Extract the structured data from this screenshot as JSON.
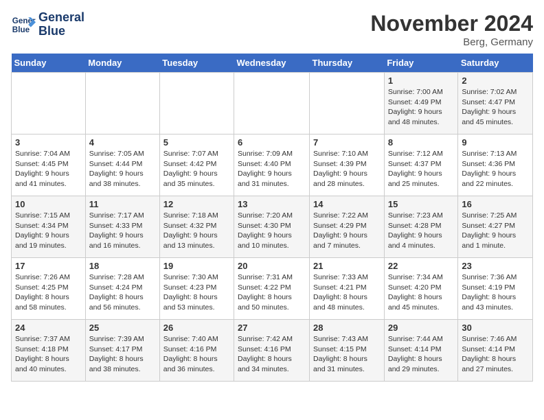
{
  "logo": {
    "line1": "General",
    "line2": "Blue"
  },
  "title": "November 2024",
  "location": "Berg, Germany",
  "days_of_week": [
    "Sunday",
    "Monday",
    "Tuesday",
    "Wednesday",
    "Thursday",
    "Friday",
    "Saturday"
  ],
  "weeks": [
    [
      {
        "day": "",
        "info": ""
      },
      {
        "day": "",
        "info": ""
      },
      {
        "day": "",
        "info": ""
      },
      {
        "day": "",
        "info": ""
      },
      {
        "day": "",
        "info": ""
      },
      {
        "day": "1",
        "info": "Sunrise: 7:00 AM\nSunset: 4:49 PM\nDaylight: 9 hours and 48 minutes."
      },
      {
        "day": "2",
        "info": "Sunrise: 7:02 AM\nSunset: 4:47 PM\nDaylight: 9 hours and 45 minutes."
      }
    ],
    [
      {
        "day": "3",
        "info": "Sunrise: 7:04 AM\nSunset: 4:45 PM\nDaylight: 9 hours and 41 minutes."
      },
      {
        "day": "4",
        "info": "Sunrise: 7:05 AM\nSunset: 4:44 PM\nDaylight: 9 hours and 38 minutes."
      },
      {
        "day": "5",
        "info": "Sunrise: 7:07 AM\nSunset: 4:42 PM\nDaylight: 9 hours and 35 minutes."
      },
      {
        "day": "6",
        "info": "Sunrise: 7:09 AM\nSunset: 4:40 PM\nDaylight: 9 hours and 31 minutes."
      },
      {
        "day": "7",
        "info": "Sunrise: 7:10 AM\nSunset: 4:39 PM\nDaylight: 9 hours and 28 minutes."
      },
      {
        "day": "8",
        "info": "Sunrise: 7:12 AM\nSunset: 4:37 PM\nDaylight: 9 hours and 25 minutes."
      },
      {
        "day": "9",
        "info": "Sunrise: 7:13 AM\nSunset: 4:36 PM\nDaylight: 9 hours and 22 minutes."
      }
    ],
    [
      {
        "day": "10",
        "info": "Sunrise: 7:15 AM\nSunset: 4:34 PM\nDaylight: 9 hours and 19 minutes."
      },
      {
        "day": "11",
        "info": "Sunrise: 7:17 AM\nSunset: 4:33 PM\nDaylight: 9 hours and 16 minutes."
      },
      {
        "day": "12",
        "info": "Sunrise: 7:18 AM\nSunset: 4:32 PM\nDaylight: 9 hours and 13 minutes."
      },
      {
        "day": "13",
        "info": "Sunrise: 7:20 AM\nSunset: 4:30 PM\nDaylight: 9 hours and 10 minutes."
      },
      {
        "day": "14",
        "info": "Sunrise: 7:22 AM\nSunset: 4:29 PM\nDaylight: 9 hours and 7 minutes."
      },
      {
        "day": "15",
        "info": "Sunrise: 7:23 AM\nSunset: 4:28 PM\nDaylight: 9 hours and 4 minutes."
      },
      {
        "day": "16",
        "info": "Sunrise: 7:25 AM\nSunset: 4:27 PM\nDaylight: 9 hours and 1 minute."
      }
    ],
    [
      {
        "day": "17",
        "info": "Sunrise: 7:26 AM\nSunset: 4:25 PM\nDaylight: 8 hours and 58 minutes."
      },
      {
        "day": "18",
        "info": "Sunrise: 7:28 AM\nSunset: 4:24 PM\nDaylight: 8 hours and 56 minutes."
      },
      {
        "day": "19",
        "info": "Sunrise: 7:30 AM\nSunset: 4:23 PM\nDaylight: 8 hours and 53 minutes."
      },
      {
        "day": "20",
        "info": "Sunrise: 7:31 AM\nSunset: 4:22 PM\nDaylight: 8 hours and 50 minutes."
      },
      {
        "day": "21",
        "info": "Sunrise: 7:33 AM\nSunset: 4:21 PM\nDaylight: 8 hours and 48 minutes."
      },
      {
        "day": "22",
        "info": "Sunrise: 7:34 AM\nSunset: 4:20 PM\nDaylight: 8 hours and 45 minutes."
      },
      {
        "day": "23",
        "info": "Sunrise: 7:36 AM\nSunset: 4:19 PM\nDaylight: 8 hours and 43 minutes."
      }
    ],
    [
      {
        "day": "24",
        "info": "Sunrise: 7:37 AM\nSunset: 4:18 PM\nDaylight: 8 hours and 40 minutes."
      },
      {
        "day": "25",
        "info": "Sunrise: 7:39 AM\nSunset: 4:17 PM\nDaylight: 8 hours and 38 minutes."
      },
      {
        "day": "26",
        "info": "Sunrise: 7:40 AM\nSunset: 4:16 PM\nDaylight: 8 hours and 36 minutes."
      },
      {
        "day": "27",
        "info": "Sunrise: 7:42 AM\nSunset: 4:16 PM\nDaylight: 8 hours and 34 minutes."
      },
      {
        "day": "28",
        "info": "Sunrise: 7:43 AM\nSunset: 4:15 PM\nDaylight: 8 hours and 31 minutes."
      },
      {
        "day": "29",
        "info": "Sunrise: 7:44 AM\nSunset: 4:14 PM\nDaylight: 8 hours and 29 minutes."
      },
      {
        "day": "30",
        "info": "Sunrise: 7:46 AM\nSunset: 4:14 PM\nDaylight: 8 hours and 27 minutes."
      }
    ]
  ]
}
